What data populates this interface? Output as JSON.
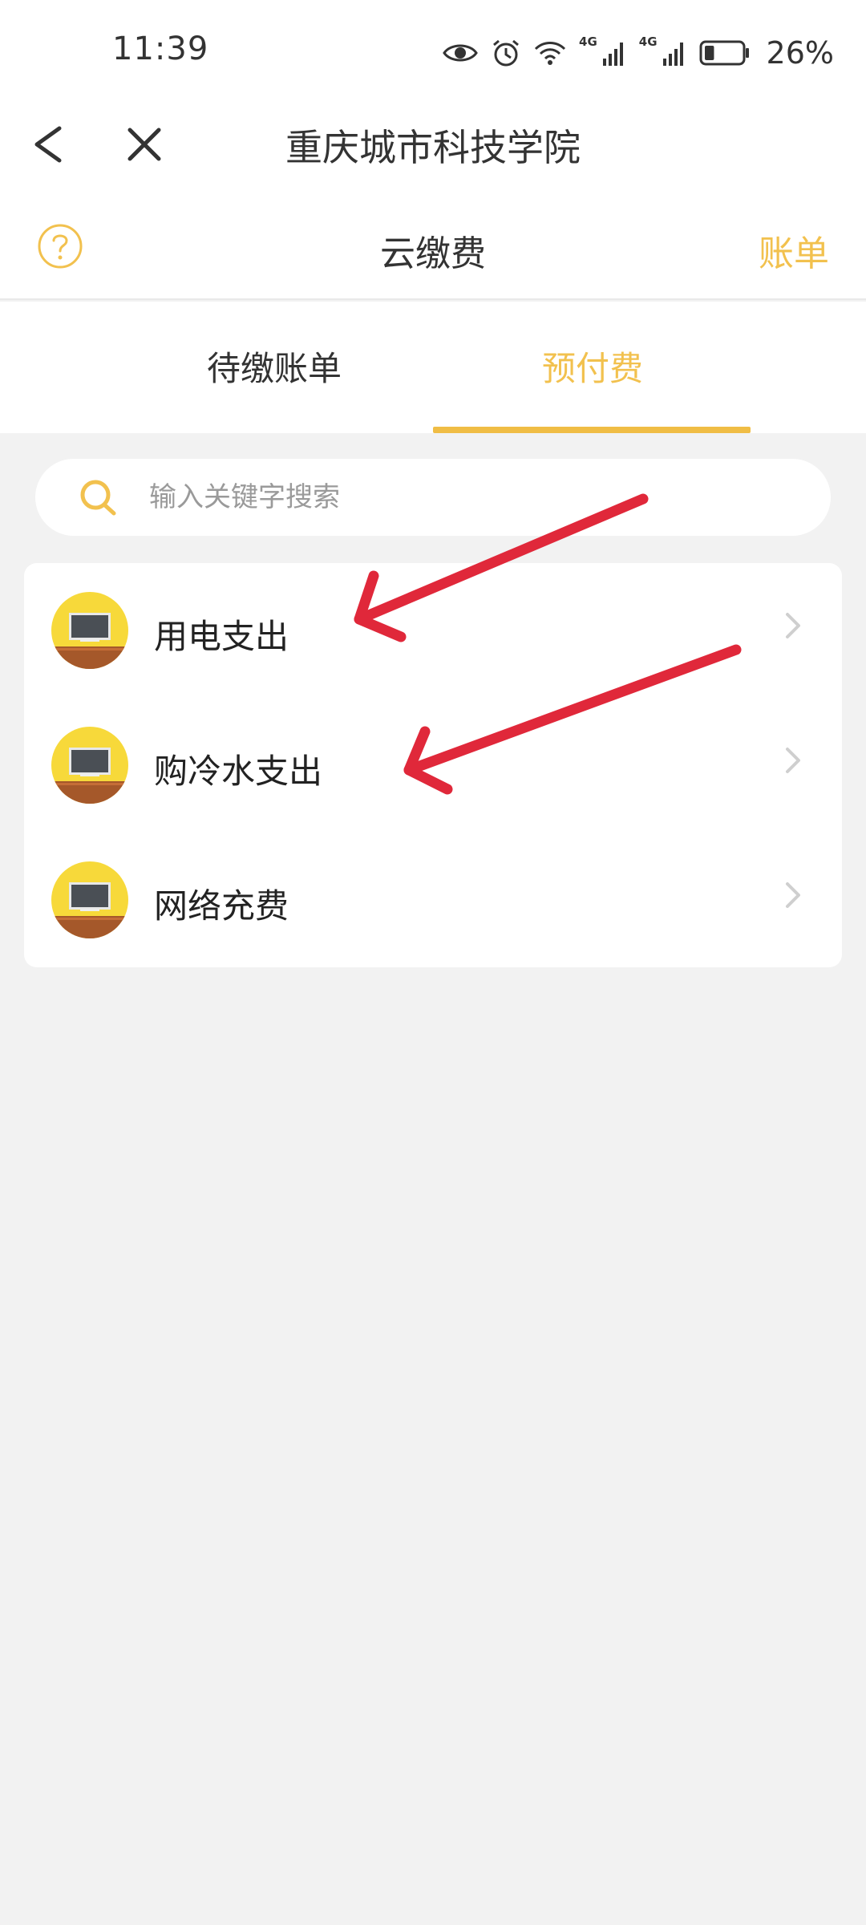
{
  "status_bar": {
    "time": "11:39",
    "network_label_1": "4G",
    "network_label_2": "4G",
    "battery_percent": "26%",
    "battery_level": 0.26,
    "icons": [
      "eye-icon",
      "alarm-icon",
      "wifi-icon",
      "signal-icon",
      "signal-icon",
      "battery-icon"
    ]
  },
  "nav": {
    "title": "重庆城市科技学院",
    "back_icon": "chevron-left-icon",
    "close_icon": "close-icon"
  },
  "header": {
    "help_icon": "question-circle-icon",
    "title": "云缴费",
    "bill_link": "账单"
  },
  "tabs": [
    {
      "label": "待缴账单",
      "active": false
    },
    {
      "label": "预付费",
      "active": true
    }
  ],
  "search": {
    "placeholder": "输入关键字搜索",
    "value": ""
  },
  "items": [
    {
      "label": "用电支出",
      "icon": "blackboard-icon"
    },
    {
      "label": "购冷水支出",
      "icon": "blackboard-icon"
    },
    {
      "label": "网络充费",
      "icon": "blackboard-icon"
    }
  ],
  "colors": {
    "accent": "#f2c14e",
    "background": "#f2f2f2",
    "annotation_arrow": "#e0283a",
    "avatar_yellow": "#f7d93a",
    "avatar_board": "#4a4f55",
    "avatar_desk": "#a5582a"
  }
}
